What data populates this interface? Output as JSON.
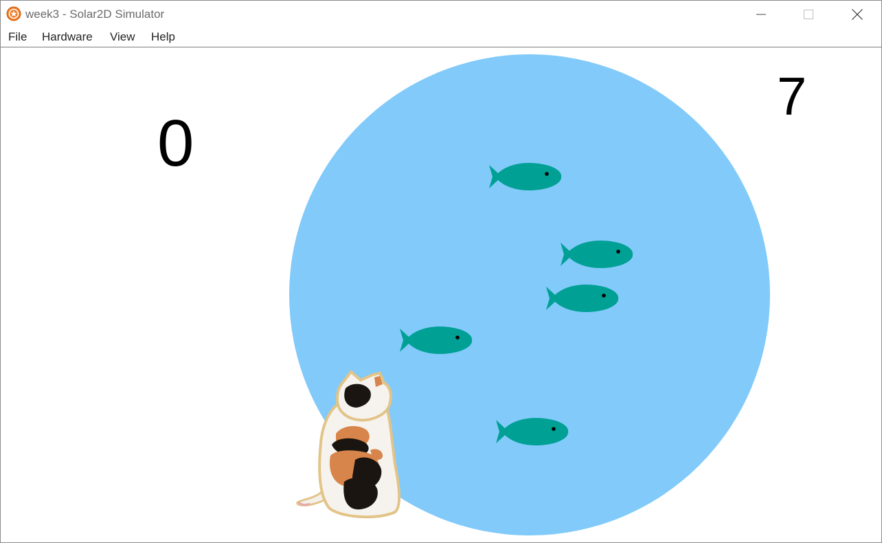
{
  "window": {
    "title": "week3 - Solar2D Simulator",
    "app_icon": "solar2d-logo-icon",
    "controls": {
      "minimize_icon": "minimize-icon",
      "maximize_icon": "maximize-icon",
      "close_icon": "close-icon"
    }
  },
  "menu": {
    "items": [
      {
        "label": "File"
      },
      {
        "label": "Hardware"
      },
      {
        "label": "View"
      },
      {
        "label": "Help"
      }
    ]
  },
  "game": {
    "score_left": "0",
    "score_right": "7",
    "pond_color": "#81cafa",
    "fish_color": "#00a094",
    "background_color": "#ffffff",
    "fish_count": 5,
    "sprites": [
      "fish",
      "fish",
      "fish",
      "fish",
      "fish",
      "calico-cat"
    ]
  }
}
